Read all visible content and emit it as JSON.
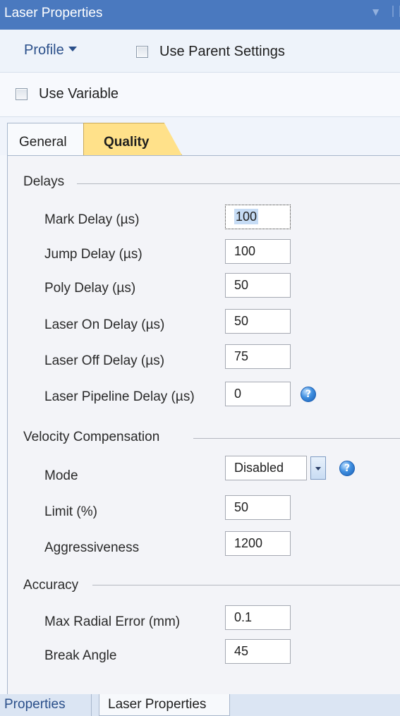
{
  "window": {
    "title": "Laser Properties"
  },
  "toolbar": {
    "profile_label": "Profile",
    "use_parent_settings_label": "Use Parent Settings",
    "use_parent_settings_checked": false,
    "use_variable_label": "Use Variable",
    "use_variable_checked": false
  },
  "tabs": [
    {
      "label": "General",
      "active": false
    },
    {
      "label": "Quality",
      "active": true
    }
  ],
  "sections": {
    "delays": {
      "title": "Delays",
      "fields": [
        {
          "label": "Mark Delay (µs)",
          "value": "100"
        },
        {
          "label": "Jump Delay (µs)",
          "value": "100"
        },
        {
          "label": "Poly Delay (µs)",
          "value": "50"
        },
        {
          "label": "Laser On Delay (µs)",
          "value": "50"
        },
        {
          "label": "Laser Off Delay (µs)",
          "value": "75"
        },
        {
          "label": "Laser Pipeline Delay (µs)",
          "value": "0"
        }
      ]
    },
    "velocity": {
      "title": "Velocity Compensation",
      "mode_label": "Mode",
      "mode_value": "Disabled",
      "limit_label": "Limit (%)",
      "limit_value": "50",
      "aggressiveness_label": "Aggressiveness",
      "aggressiveness_value": "1200"
    },
    "accuracy": {
      "title": "Accuracy",
      "max_radial_error_label": "Max Radial Error (mm)",
      "max_radial_error_value": "0.1",
      "break_angle_label": "Break Angle",
      "break_angle_value": "45"
    }
  },
  "bottom_tabs": [
    {
      "label": "Properties",
      "active": false
    },
    {
      "label": "Laser Properties",
      "active": true
    }
  ],
  "colors": {
    "title_bar": "#4a79bf",
    "active_tab": "#ffe18a",
    "help_icon": "#3f8fe0"
  }
}
